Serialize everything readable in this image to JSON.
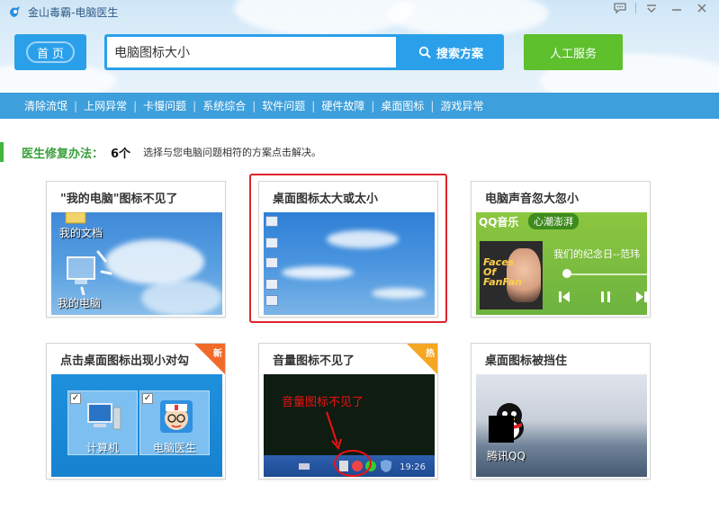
{
  "window": {
    "title": "金山毒霸-电脑医生",
    "controls": [
      "chat-icon",
      "menu-icon",
      "minimize-icon",
      "close-icon"
    ]
  },
  "header": {
    "home_label": "首页",
    "search": {
      "value": "电脑图标大小",
      "button_label": "搜索方案"
    },
    "service_label": "人工服务"
  },
  "nav": {
    "items": [
      "清除流氓",
      "上网异常",
      "卡慢问题",
      "系统综合",
      "软件问题",
      "硬件故障",
      "桌面图标",
      "游戏异常"
    ]
  },
  "info": {
    "label": "医生修复办法：",
    "count": "6个",
    "desc": "选择与您电脑问题相符的方案点击解决。"
  },
  "cards": [
    {
      "title": "\"我的电脑\"图标不见了",
      "labels": [
        "我的文档",
        "我的电脑"
      ]
    },
    {
      "title": "桌面图标太大或太小",
      "selected": true
    },
    {
      "title": "电脑声音忽大忽小",
      "brand": "QQ音乐",
      "mood": "心潮澎湃",
      "song": "我们的纪念日--范玮",
      "album_text": "Faces Of FanFan"
    },
    {
      "title": "点击桌面图标出现小对勾",
      "badge": "新",
      "tiles": [
        "计算机",
        "电脑医生"
      ]
    },
    {
      "title": "音量图标不见了",
      "badge": "热",
      "overlay_text": "音量图标不见了",
      "time": "19:26"
    },
    {
      "title": "桌面图标被挡住",
      "icon_label": "腾讯QQ"
    }
  ],
  "colors": {
    "accent_blue": "#2ba0ea",
    "nav_blue": "#3d9fdb",
    "green": "#5ec02d",
    "highlight_red": "#e0242b"
  }
}
